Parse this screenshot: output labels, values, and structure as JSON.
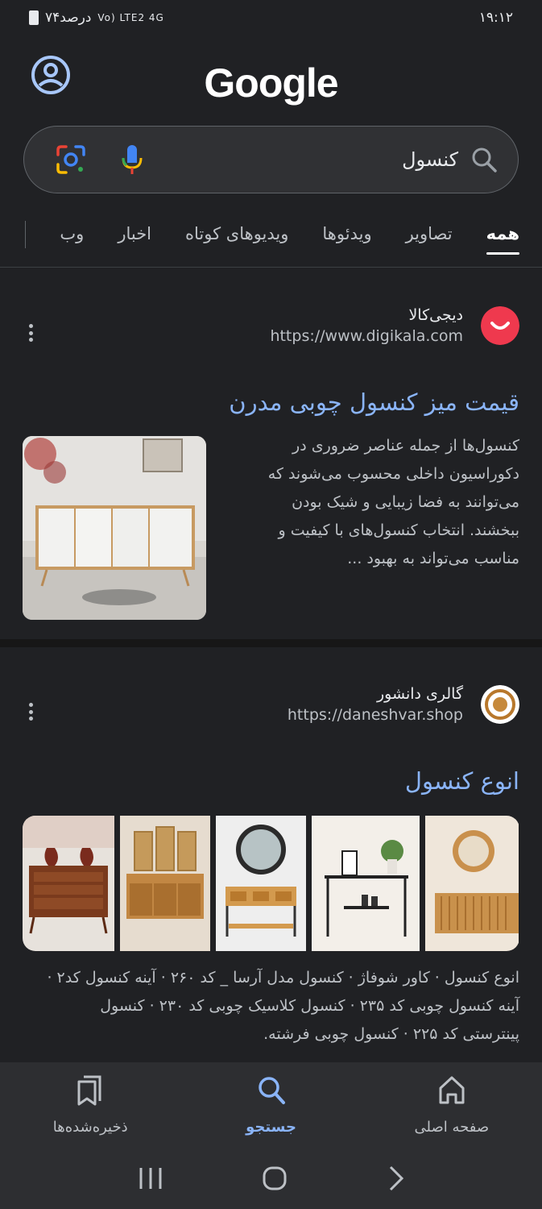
{
  "status_bar": {
    "time": "۱۹:۱۲",
    "battery_text": "۷۴درصد",
    "signal_text": "Vo) LTE2 4G"
  },
  "header": {
    "logo": "Google",
    "avatar_icon": "account-circle-icon"
  },
  "search": {
    "query": "کنسول",
    "icons": [
      "search-icon",
      "mic-icon",
      "lens-icon"
    ]
  },
  "tabs": [
    {
      "label": "همه",
      "active": true
    },
    {
      "label": "تصاویر",
      "active": false
    },
    {
      "label": "ویدئوها",
      "active": false
    },
    {
      "label": "ویدیوهای کوتاه",
      "active": false
    },
    {
      "label": "اخبار",
      "active": false
    },
    {
      "label": "وب",
      "active": false
    }
  ],
  "results": [
    {
      "site_name": "دیجی‌کالا",
      "url": "https://www.digikala.com",
      "title": "قیمت میز کنسول چوبی مدرن",
      "snippet": "کنسول‌ها از جمله عناصر ضروری در دکوراسیون داخلی محسوب می‌شوند که می‌توانند به فضا زیبایی و شیک بودن ببخشند. انتخاب کنسول‌های با کیفیت و مناسب می‌تواند به بهبود ...",
      "favicon_color": "#ef394e"
    },
    {
      "site_name": "گالری دانشور",
      "url": "https://daneshvar.shop",
      "title": "انوع کنسول",
      "snippet": "انوع کنسول · کاور شوفاژ · کنسول مدل آرسا _ کد ۲۶۰ · آینه کنسول کد۲ · آینه کنسول چوبی کد ۲۳۵ · کنسول کلاسیک چوبی کد ۲۳۰ · کنسول پینترستی کد ۲۲۵ · کنسول چوبی فرشته."
    }
  ],
  "bottom_nav": [
    {
      "label": "صفحه اصلی",
      "icon": "home-icon",
      "active": false
    },
    {
      "label": "جستجو",
      "icon": "search-icon",
      "active": true
    },
    {
      "label": "ذخیره‌شده‌ها",
      "icon": "bookmarks-icon",
      "active": false
    }
  ],
  "system_nav": [
    "back-icon",
    "home-circle-icon",
    "recents-icon"
  ],
  "colors": {
    "background": "#202124",
    "link": "#8ab4f8",
    "accent": "#8ab4f8"
  }
}
